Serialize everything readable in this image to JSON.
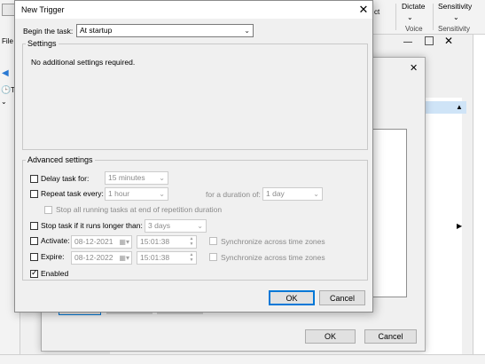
{
  "background": {
    "left_labels": [
      "File",
      "T",
      "T"
    ],
    "ribbon": {
      "dictate": "Dictate",
      "voice": "Voice",
      "sensitivity": "Sensitivity",
      "sensitivity_group": "Sensitivity",
      "fragment": "ct"
    },
    "dialog_buttons": {
      "ok": "OK",
      "cancel": "Cancel"
    }
  },
  "dialog": {
    "title": "New Trigger",
    "begin_label": "Begin the task:",
    "begin_value": "At startup",
    "settings_label": "Settings",
    "settings_text": "No additional settings required.",
    "advanced_label": "Advanced settings",
    "delay": {
      "label": "Delay task for:",
      "value": "15 minutes",
      "checked": false
    },
    "repeat": {
      "label": "Repeat task every:",
      "value": "1 hour",
      "duration_label": "for a duration of:",
      "duration_value": "1 day",
      "checked": false
    },
    "stop_running": {
      "label": "Stop all running tasks at end of repetition duration",
      "checked": false
    },
    "stop_longer": {
      "label": "Stop task if it runs longer than:",
      "value": "3 days",
      "checked": false
    },
    "activate": {
      "label": "Activate:",
      "date": "08-12-2021",
      "time": "15:01:38",
      "sync_label": "Synchronize across time zones",
      "checked": false
    },
    "expire": {
      "label": "Expire:",
      "date": "08-12-2022",
      "time": "15:01:38",
      "sync_label": "Synchronize across time zones",
      "checked": false
    },
    "enabled": {
      "label": "Enabled",
      "checked": true
    },
    "ok_label": "OK",
    "cancel_label": "Cancel"
  },
  "icons": {
    "close": "close-icon",
    "dropdown": "chevron-down-icon",
    "calendar": "calendar-icon",
    "spinner": "spinner-icon"
  }
}
